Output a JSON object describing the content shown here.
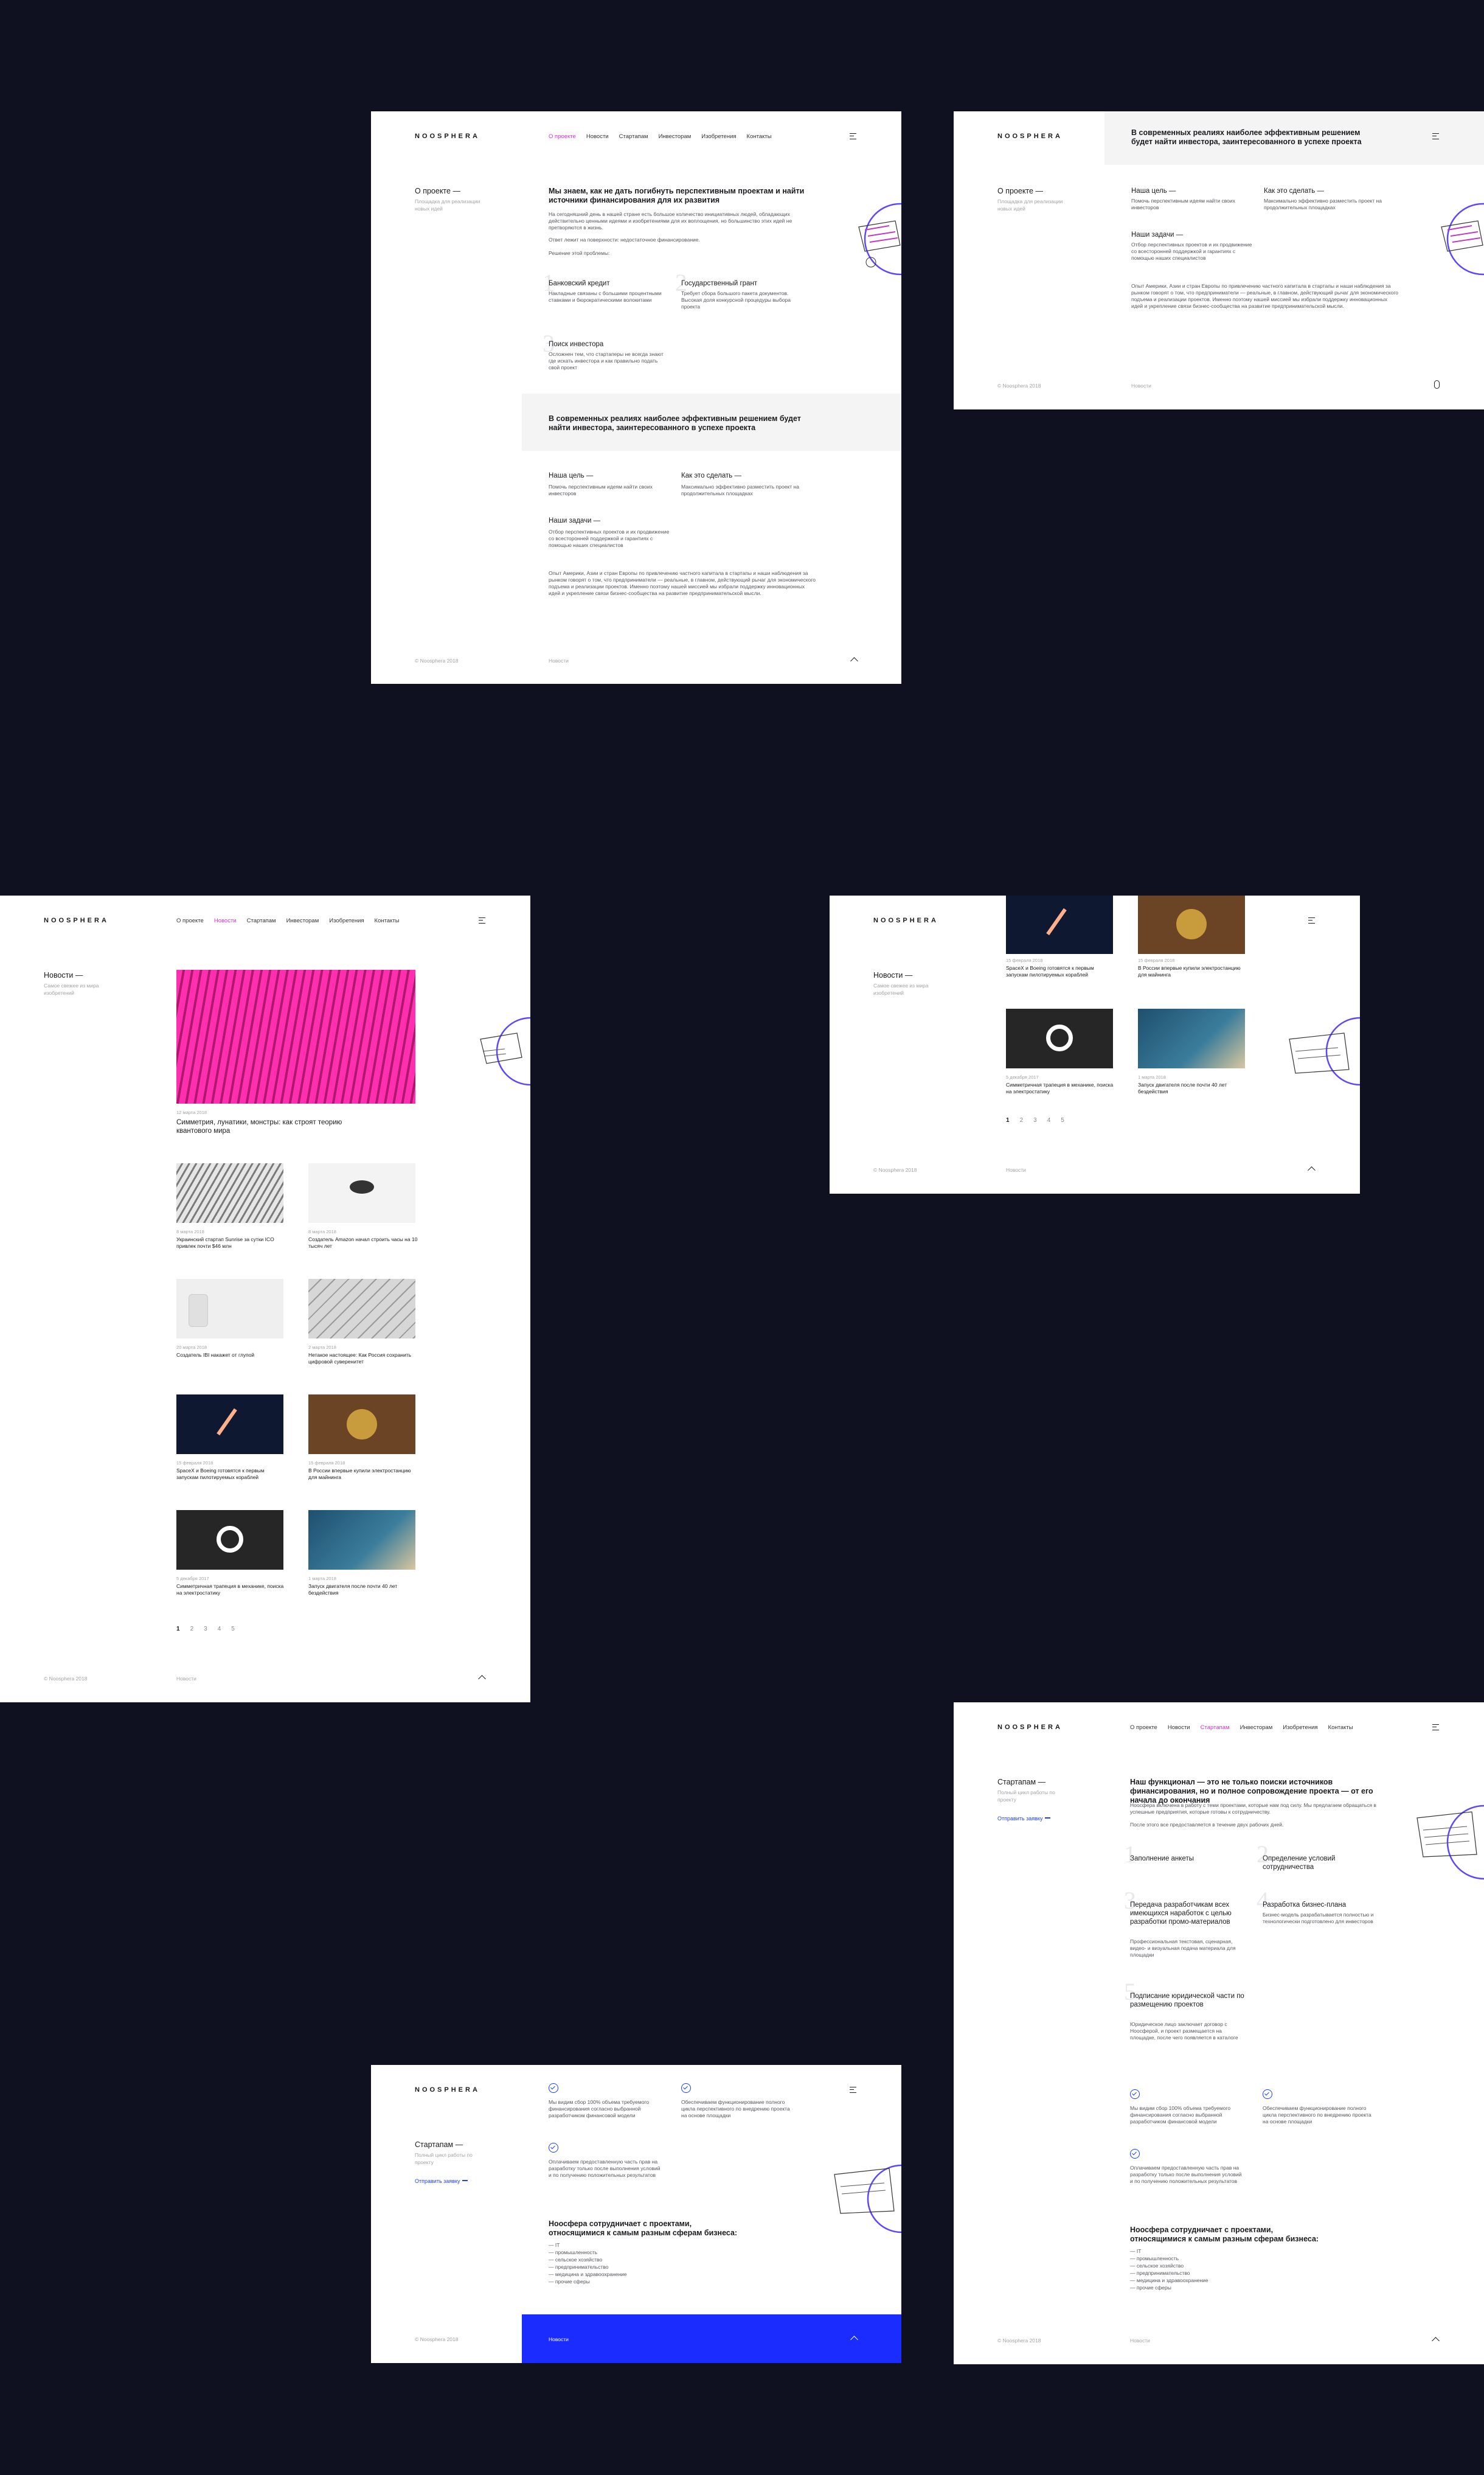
{
  "brand": {
    "logo": "NOOSPHERA",
    "copyright": "© Noosphera 2018"
  },
  "nav": [
    "О проекте",
    "Новости",
    "Стартапам",
    "Инвесторам",
    "Изобретения",
    "Контакты"
  ],
  "footer": {
    "news": "Новости"
  },
  "about": {
    "title": "О проекте —",
    "subtitle": "Площадка для реализации новых идей",
    "lead": "Мы знаем, как не дать погибнуть перспективным проектам и найти источники финансирования для их развития",
    "p1": "На сегодняшний день в нашей стране есть большое количество инициативных людей, обладающих действительно ценными идеями и изобретениями для их воплощения, но большинство этих идей не претворяются в жизнь.",
    "p2": "Ответ лежит на поверхности: недостаточное финансирование.",
    "p3": "Решение этой проблемы:",
    "items": [
      {
        "n": "1",
        "title": "Банковский кредит",
        "text": "Накладные связаны с большими процентными ставками и бюрократическими волокитами"
      },
      {
        "n": "2",
        "title": "Государственный грант",
        "text": "Требует сбора большого пакета документов. Высокая доля конкурсной процедуры выбора проекта"
      },
      {
        "n": "3",
        "title": "Поиск инвестора",
        "text": "Осложнен тем, что стартаперы не всегда знают где искать инвестора и как правильно подать свой проект"
      }
    ],
    "band": "В современных реалиях наиболее эффективным решением будет найти инвестора, заинтересованного в успехе проекта",
    "goal_title": "Наша цель —",
    "goal_text": "Помочь перспективным идеям найти своих инвесторов",
    "how_title": "Как это сделать —",
    "how_text": "Максимально эффективно разместить проект на продолжительных площадках",
    "tasks_title": "Наши задачи —",
    "tasks_text": "Отбор перспективных проектов и их продвижение со всесторонней поддержкой и гарантиях с помощью наших специалистов",
    "closing": "Опыт Америки, Азии и стран Европы по привлечению частного капитала в стартапы и наши наблюдения за рынком говорят о том, что предприниматели — реальные, в главном, действующий рычаг для экономического подъема и реализации проектов. Именно поэтому нашей миссией мы избрали поддержку инновационных идей и укрепление связи бизнес-сообщества на развитие предпринимательской мысли."
  },
  "news": {
    "title": "Новости —",
    "subtitle": "Самое свежее из мира изобретений",
    "feature": {
      "date": "12 марта 2018",
      "title": "Симметрия, лунатики, монстры: как строят теорию квантового мира"
    },
    "items": [
      {
        "date": "8 марта 2018",
        "title": "Украинский стартап Sunrise за сутки ICO привлек почти $46 млн"
      },
      {
        "date": "8 марта 2018",
        "title": "Создатель Amazon начал строить часы на 10 тысяч лет"
      },
      {
        "date": "20 марта 2018",
        "title": "Создатель IBI накажет от глупой"
      },
      {
        "date": "2 марта 2018",
        "title": "Нетакое настоящее: Как Россия сохранить цифровой суверенитет"
      },
      {
        "date": "15 февраля 2018",
        "title": "SpaceX и Boeing готовятся к первым запускам пилотируемых кораблей"
      },
      {
        "date": "15 февраля 2018",
        "title": "В России впервые купили электростанцию для майнинга"
      },
      {
        "date": "5 декабря 2017",
        "title": "Симметричная трапеция в механике, поиска на электростатику"
      },
      {
        "date": "1 марта 2018",
        "title": "Запуск двигателя после почти 40 лет бездействия"
      }
    ],
    "pages": [
      "1",
      "2",
      "3",
      "4",
      "5"
    ]
  },
  "startups": {
    "title": "Стартапам —",
    "subtitle": "Полный цикл работы по проекту",
    "cta": "Отправить заявку",
    "lead": "Наш функционал — это не только поиски источников финансирования, но и полное сопровождение проекта — от его начала до окончания",
    "intro": "Ноосфера включена в работу с теми проектами, которые нам под силу. Мы предлагаем обращаться в успешные предприятия, которые готовы к сотрудничеству.",
    "intro2": "После этого все предоставляется в течение двух рабочих дней.",
    "steps": [
      {
        "n": "1",
        "title": "Заполнение анкеты",
        "text": ""
      },
      {
        "n": "2",
        "title": "Определение условий сотрудничества",
        "text": ""
      },
      {
        "n": "3",
        "title": "Передача разработчикам всех имеющихся наработок с целью разработки промо-материалов",
        "text": "Профессиональная текстовая, сценарная, видео- и визуальная подача материала для площадки"
      },
      {
        "n": "4",
        "title": "Разработка бизнес-плана",
        "text": "Бизнес-модель разрабатывается полностью и технологически подготовлено для инвесторов"
      },
      {
        "n": "5",
        "title": "Подписание юридической части по размещению проектов",
        "text": "Юридическое лицо заключает договор с Ноосферой, и проект размещается на площадке, после чего появляется в каталоге"
      }
    ],
    "checks": [
      {
        "text": "Мы видим сбор 100% объема требуемого финансирования согласно выбранной разработчиком финансовой модели"
      },
      {
        "text": "Обеспечиваем функционирование полного цикла перспективного по внедрению проекта на основе площадки"
      },
      {
        "text": "Оплачиваем предоставленную часть прав на разработку только после выполнения условий и по получению положительных результатов"
      }
    ],
    "spheres_title": "Ноосфера сотрудничает с проектами, относящимися к самым разным сферам бизнеса:",
    "spheres": [
      "— IT",
      "— промышленность",
      "— сельское хозяйство",
      "— предпринимательство",
      "— медицина и здравоохранение",
      "— прочие сферы"
    ]
  },
  "colors": {
    "bg": "#0f1020",
    "accent": "#d62fd6",
    "blue": "#1a3fff"
  }
}
